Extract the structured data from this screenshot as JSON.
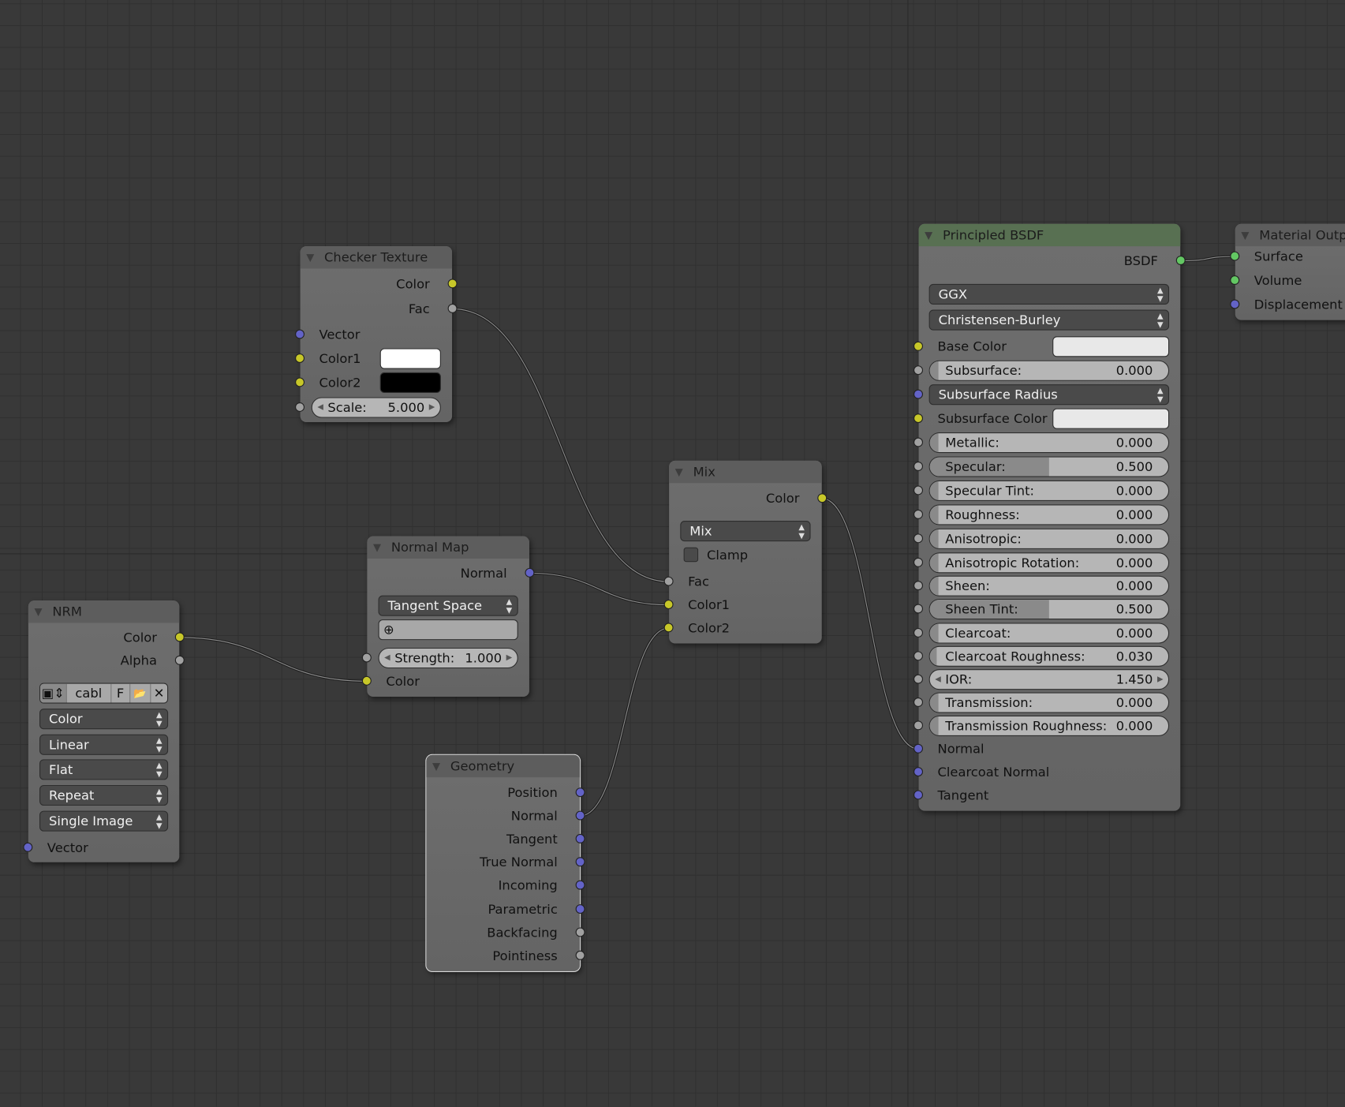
{
  "colors": {
    "yellow": "#c7c729",
    "gray": "#a1a1a1",
    "blue": "#6363c7",
    "green": "#63c763",
    "white": "#ffffff",
    "black": "#000000",
    "light": "#e8e8e8"
  },
  "nodes": [
    {
      "id": "checker",
      "title": "Checker Texture",
      "rows": [
        {
          "type": "out",
          "label": "Color",
          "socket": "yellow"
        },
        {
          "type": "out",
          "label": "Fac",
          "socket": "gray"
        },
        {
          "type": "in",
          "label": "Vector",
          "socket": "blue"
        },
        {
          "type": "color",
          "label": "Color1",
          "socket": "yellow",
          "swatch": "white"
        },
        {
          "type": "color",
          "label": "Color2",
          "socket": "yellow",
          "swatch": "black"
        },
        {
          "type": "slider",
          "label": "Scale:",
          "value": "5.000",
          "socket": "gray",
          "fill": 0,
          "arrows": true
        }
      ]
    },
    {
      "id": "normalmap",
      "title": "Normal Map",
      "rows": [
        {
          "type": "out",
          "label": "Normal",
          "socket": "blue"
        },
        {
          "type": "dropdown",
          "label": "Tangent Space"
        },
        {
          "type": "uv",
          "icon": "uv-map-icon"
        },
        {
          "type": "slider",
          "label": "Strength:",
          "value": "1.000",
          "socket": "gray",
          "fill": 0,
          "arrows": true
        },
        {
          "type": "in",
          "label": "Color",
          "socket": "yellow"
        }
      ]
    },
    {
      "id": "nrm",
      "title": "NRM",
      "rows": [
        {
          "type": "out",
          "label": "Color",
          "socket": "yellow"
        },
        {
          "type": "out",
          "label": "Alpha",
          "socket": "gray"
        },
        {
          "type": "image",
          "name": "cabl",
          "flag": "F"
        },
        {
          "type": "dropdown",
          "label": "Color"
        },
        {
          "type": "dropdown",
          "label": "Linear"
        },
        {
          "type": "dropdown",
          "label": "Flat"
        },
        {
          "type": "dropdown",
          "label": "Repeat"
        },
        {
          "type": "dropdown",
          "label": "Single Image"
        },
        {
          "type": "in",
          "label": "Vector",
          "socket": "blue"
        }
      ]
    },
    {
      "id": "geometry",
      "title": "Geometry",
      "selected": true,
      "rows": [
        {
          "type": "out",
          "label": "Position",
          "socket": "blue"
        },
        {
          "type": "out",
          "label": "Normal",
          "socket": "blue"
        },
        {
          "type": "out",
          "label": "Tangent",
          "socket": "blue"
        },
        {
          "type": "out",
          "label": "True Normal",
          "socket": "blue"
        },
        {
          "type": "out",
          "label": "Incoming",
          "socket": "blue"
        },
        {
          "type": "out",
          "label": "Parametric",
          "socket": "blue"
        },
        {
          "type": "out",
          "label": "Backfacing",
          "socket": "gray"
        },
        {
          "type": "out",
          "label": "Pointiness",
          "socket": "gray"
        }
      ]
    },
    {
      "id": "mix",
      "title": "Mix",
      "rows": [
        {
          "type": "out",
          "label": "Color",
          "socket": "yellow"
        },
        {
          "type": "dropdown",
          "label": "Mix"
        },
        {
          "type": "checkbox",
          "label": "Clamp",
          "checked": false
        },
        {
          "type": "in",
          "label": "Fac",
          "socket": "gray"
        },
        {
          "type": "in",
          "label": "Color1",
          "socket": "yellow"
        },
        {
          "type": "in",
          "label": "Color2",
          "socket": "yellow"
        }
      ]
    },
    {
      "id": "principled",
      "title": "Principled BSDF",
      "green": true,
      "rows": [
        {
          "type": "out",
          "label": "BSDF",
          "socket": "green"
        },
        {
          "type": "dropdown",
          "label": "GGX"
        },
        {
          "type": "dropdown",
          "label": "Christensen-Burley"
        },
        {
          "type": "color",
          "label": "Base Color",
          "socket": "yellow",
          "swatch": "light",
          "wide": true
        },
        {
          "type": "slider",
          "label": "Subsurface:",
          "value": "0.000",
          "socket": "gray",
          "fill": 0
        },
        {
          "type": "dropdown",
          "label": "Subsurface Radius",
          "socket": "blue"
        },
        {
          "type": "color",
          "label": "Subsurface Color",
          "socket": "yellow",
          "swatch": "light",
          "wide": true
        },
        {
          "type": "slider",
          "label": "Metallic:",
          "value": "0.000",
          "socket": "gray",
          "fill": 0
        },
        {
          "type": "slider",
          "label": "Specular:",
          "value": "0.500",
          "socket": "gray",
          "fill": 0.5
        },
        {
          "type": "slider",
          "label": "Specular Tint:",
          "value": "0.000",
          "socket": "gray",
          "fill": 0
        },
        {
          "type": "slider",
          "label": "Roughness:",
          "value": "0.000",
          "socket": "gray",
          "fill": 0
        },
        {
          "type": "slider",
          "label": "Anisotropic:",
          "value": "0.000",
          "socket": "gray",
          "fill": 0
        },
        {
          "type": "slider",
          "label": "Anisotropic Rotation:",
          "value": "0.000",
          "socket": "gray",
          "fill": 0
        },
        {
          "type": "slider",
          "label": "Sheen:",
          "value": "0.000",
          "socket": "gray",
          "fill": 0
        },
        {
          "type": "slider",
          "label": "Sheen Tint:",
          "value": "0.500",
          "socket": "gray",
          "fill": 0.5
        },
        {
          "type": "slider",
          "label": "Clearcoat:",
          "value": "0.000",
          "socket": "gray",
          "fill": 0
        },
        {
          "type": "slider",
          "label": "Clearcoat Roughness:",
          "value": "0.030",
          "socket": "gray",
          "fill": 0.03
        },
        {
          "type": "slider",
          "label": "IOR:",
          "value": "1.450",
          "socket": "gray",
          "fill": 0,
          "arrows": true
        },
        {
          "type": "slider",
          "label": "Transmission:",
          "value": "0.000",
          "socket": "gray",
          "fill": 0
        },
        {
          "type": "slider",
          "label": "Transmission Roughness:",
          "value": "0.000",
          "socket": "gray",
          "fill": 0
        },
        {
          "type": "in",
          "label": "Normal",
          "socket": "blue"
        },
        {
          "type": "in",
          "label": "Clearcoat Normal",
          "socket": "blue"
        },
        {
          "type": "in",
          "label": "Tangent",
          "socket": "blue"
        }
      ]
    },
    {
      "id": "output",
      "title": "Material Output",
      "rows": [
        {
          "type": "in",
          "label": "Surface",
          "socket": "green"
        },
        {
          "type": "in",
          "label": "Volume",
          "socket": "green"
        },
        {
          "type": "in",
          "label": "Displacement",
          "socket": "blue"
        }
      ]
    }
  ],
  "links": [
    {
      "from": "Checker Texture.Fac",
      "to": "Mix.Fac"
    },
    {
      "from": "Normal Map.Normal",
      "to": "Mix.Color1"
    },
    {
      "from": "NRM.Color",
      "to": "Normal Map.Color"
    },
    {
      "from": "Geometry.Normal",
      "to": "Mix.Color2"
    },
    {
      "from": "Mix.Color",
      "to": "Principled BSDF.Normal"
    },
    {
      "from": "Principled BSDF.BSDF",
      "to": "Material Output.Surface"
    }
  ]
}
